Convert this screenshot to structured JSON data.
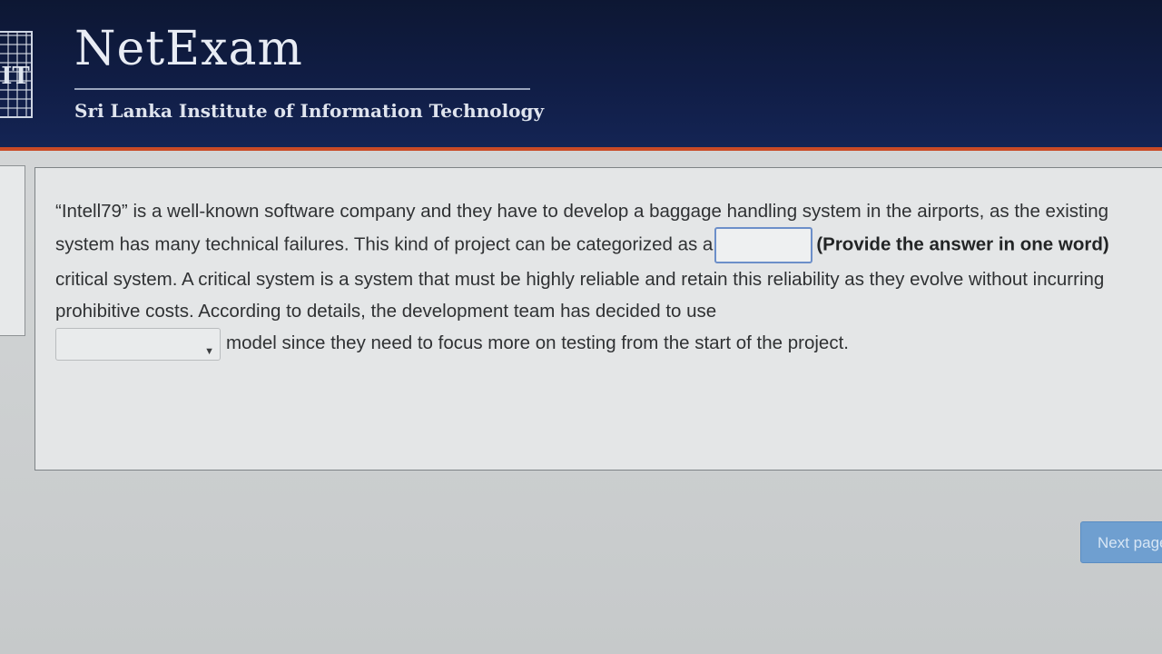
{
  "header": {
    "logo_text": "IT",
    "brand": "NetExam",
    "institute": "Sri Lanka Institute of Information Technology"
  },
  "question": {
    "part1": "“Intell79” is a well-known software company and they have to develop a baggage handling system in the airports, as the existing system has many technical failures. This kind of project can be categorized as a",
    "answer_value": "",
    "hint": "(Provide the answer in one word)",
    "part2": "critical system. A critical system is a system that must be highly reliable and retain this reliability as they evolve without incurring prohibitive costs. According to details, the development team has decided to use",
    "select_value": "",
    "part3": "model since they need to focus more on testing from the start of the project."
  },
  "navigation": {
    "next_label": "Next page"
  }
}
